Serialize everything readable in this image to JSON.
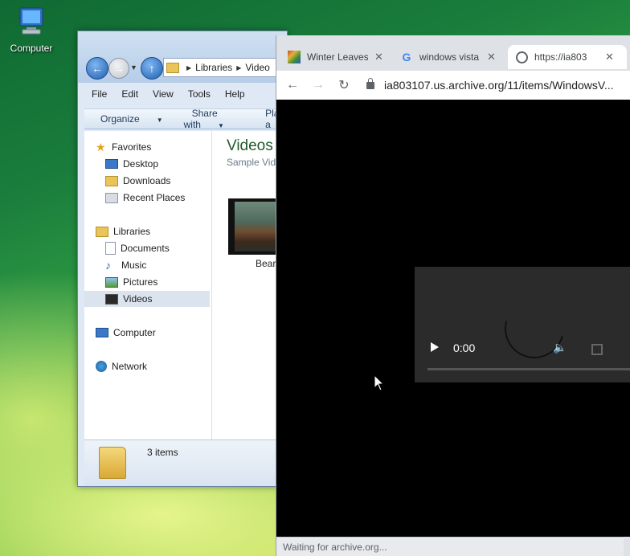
{
  "desktop": {
    "icons": [
      {
        "label": "Computer",
        "icon": "computer-icon"
      }
    ]
  },
  "explorer": {
    "address_root": "Libraries",
    "address_current": "Video",
    "menu": [
      "File",
      "Edit",
      "View",
      "Tools",
      "Help"
    ],
    "commands": [
      "Organize",
      "Share with",
      "Play a"
    ],
    "nav": {
      "favorites_header": "Favorites",
      "favorites": [
        "Desktop",
        "Downloads",
        "Recent Places"
      ],
      "libraries_header": "Libraries",
      "libraries": [
        "Documents",
        "Music",
        "Pictures",
        "Videos"
      ],
      "computer": "Computer",
      "network": "Network"
    },
    "library_title": "Videos",
    "library_subtitle": "Sample Vid",
    "item_label": "Bear",
    "details_count": "3 items"
  },
  "browser": {
    "tabs": [
      {
        "title": "Winter Leaves",
        "favicon": "winter-leaves-icon",
        "active": false
      },
      {
        "title": "windows vista",
        "favicon": "google-icon",
        "active": false
      },
      {
        "title": "https://ia803",
        "favicon": "globe-icon",
        "active": true
      }
    ],
    "url": "ia803107.us.archive.org/11/items/WindowsV...",
    "video": {
      "time": "0:00"
    },
    "status": "Waiting for archive.org..."
  }
}
